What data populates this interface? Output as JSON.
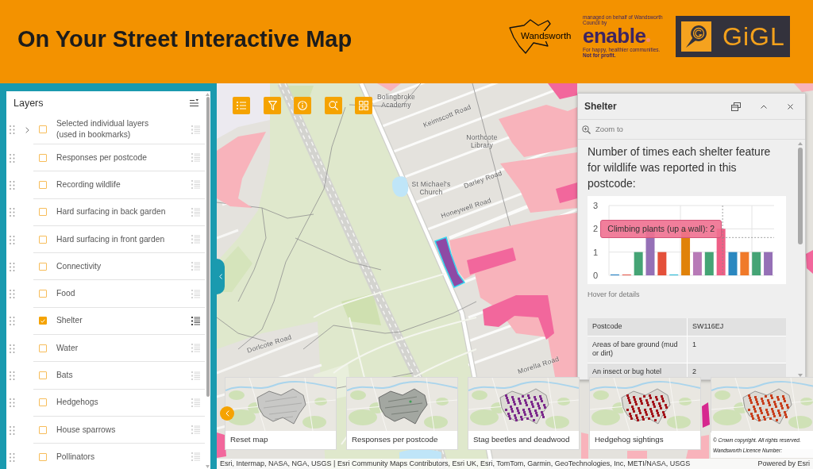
{
  "header": {
    "title": "On Your Street Interactive Map",
    "logos": {
      "wandsworth": "Wandsworth",
      "enable": {
        "managed_by": "managed on behalf of Wandsworth Council by",
        "name": "enable",
        "tagline": "For happy, healthier communities.",
        "note": "Not for profit."
      },
      "gigl": "GiGL"
    }
  },
  "layers_panel": {
    "title": "Layers",
    "items": [
      {
        "kind": "group",
        "label": "Selected individual layers (used in bookmarks)",
        "expanded": false,
        "checked": false
      },
      {
        "kind": "layer",
        "label": "Responses per postcode",
        "checked": false
      },
      {
        "kind": "layer",
        "label": "Recording wildlife",
        "checked": false
      },
      {
        "kind": "layer",
        "label": "Hard surfacing in back garden",
        "checked": false
      },
      {
        "kind": "layer",
        "label": "Hard surfacing in front garden",
        "checked": false
      },
      {
        "kind": "layer",
        "label": "Connectivity",
        "checked": false
      },
      {
        "kind": "layer",
        "label": "Food",
        "checked": false
      },
      {
        "kind": "layer",
        "label": "Shelter",
        "checked": true
      },
      {
        "kind": "layer",
        "label": "Water",
        "checked": false
      },
      {
        "kind": "layer",
        "label": "Bats",
        "checked": false
      },
      {
        "kind": "layer",
        "label": "Hedgehogs",
        "checked": false
      },
      {
        "kind": "layer",
        "label": "House sparrows",
        "checked": false
      },
      {
        "kind": "layer",
        "label": "Pollinators",
        "checked": false
      }
    ]
  },
  "map": {
    "labels": [
      "Bolingbroke Academy",
      "Keimscott Road",
      "Northcote Library",
      "St Michael's Church",
      "Darley Road",
      "Honeywell Road",
      "Dorlcote Road",
      "Morella Road"
    ]
  },
  "popup": {
    "title": "Shelter",
    "zoom_action": "Zoom to",
    "heading": "Number of times each shelter feature for wildlife was reported in this postcode:",
    "chart_data": {
      "type": "bar",
      "ylim": [
        0,
        3
      ],
      "yticks": [
        0,
        1,
        2,
        3
      ],
      "series": [
        {
          "values": [
            0,
            0,
            1,
            2,
            1,
            0,
            2,
            1,
            1,
            2,
            1,
            1,
            1,
            1
          ],
          "colors": [
            "#2f86c6",
            "#e8665a",
            "#45a475",
            "#9570b6",
            "#e4503a",
            "#35bcd8",
            "#e0820a",
            "#b87ab7",
            "#45a475",
            "#ee5f86",
            "#2a88c0",
            "#f07a2a",
            "#45a475",
            "#9570b6"
          ]
        }
      ],
      "annotations": [
        {
          "text": "Climbing plants (up a wall): 2"
        }
      ]
    },
    "hint": "Hover for details",
    "table": {
      "rows": [
        {
          "label": "Postcode",
          "value": "SW116EJ"
        },
        {
          "label": "Areas of bare ground (mud or dirt)",
          "value": "1"
        },
        {
          "label": "An insect or bug hotel",
          "value": "2"
        }
      ]
    }
  },
  "bookmarks": {
    "items": [
      {
        "label": "Reset map",
        "kind": "outline"
      },
      {
        "label": "Responses per postcode",
        "kind": "shaded"
      },
      {
        "label": "Stag beetles and deadwood",
        "kind": "dots",
        "color": "#7d2b8c"
      },
      {
        "label": "Hedgehog sightings",
        "kind": "dots",
        "color": "#a3161c"
      },
      {
        "kind": "dots",
        "color": "#c8401e"
      }
    ]
  },
  "copyright": {
    "lines": [
      "© Crown copyright. All rights reserved.",
      "Wandsworth Licence Number:"
    ]
  },
  "attribution": {
    "sources": "Esri, Intermap, NASA, NGA, USGS | Esri Community Maps Contributors, Esri UK, Esri, TomTom, Garmin, GeoTechnologies, Inc, METI/NASA, USGS",
    "powered_by": "Powered by Esri"
  }
}
